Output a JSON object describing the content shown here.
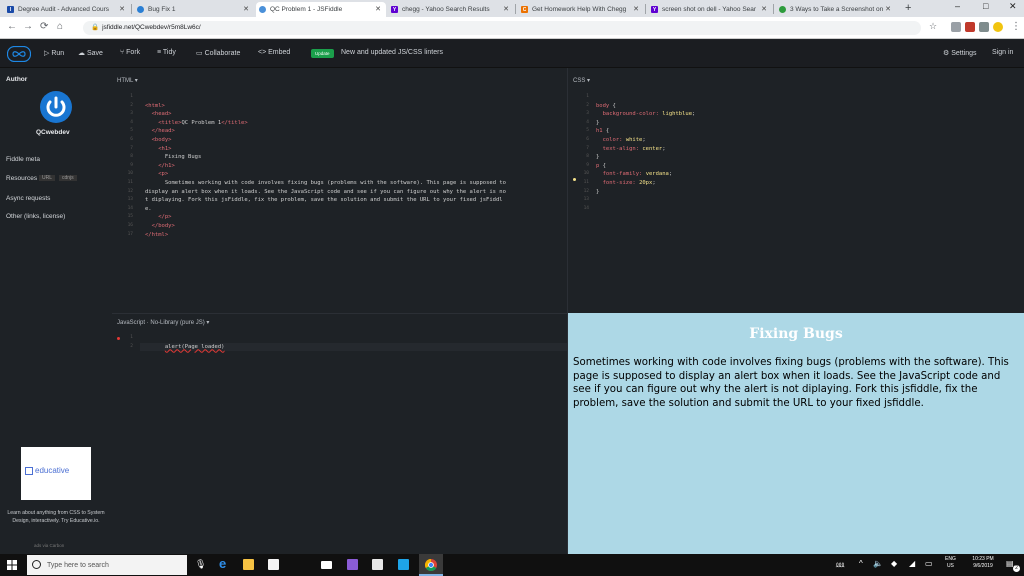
{
  "browser": {
    "tabs": [
      {
        "title": "Degree Audit - Advanced Cours",
        "color": "#1a4aa8",
        "glyph": "I"
      },
      {
        "title": "Bug Fix 1",
        "color": "#2a7fd4",
        "glyph": ""
      },
      {
        "title": "QC Problem 1 - JSFiddle",
        "color": "#4a90d9",
        "glyph": ""
      },
      {
        "title": "chegg - Yahoo Search Results",
        "color": "#5f01d1",
        "glyph": "Y"
      },
      {
        "title": "Get Homework Help With Chegg",
        "color": "#eb7100",
        "glyph": "C"
      },
      {
        "title": "screen shot on dell - Yahoo Sear",
        "color": "#5f01d1",
        "glyph": "Y"
      },
      {
        "title": "3 Ways to Take a Screenshot on",
        "color": "#2e9c3d",
        "glyph": ""
      }
    ],
    "url": "jsfiddle.net/QCwebdev/r5m8Lw6c/",
    "new_tab": "+",
    "window_controls": [
      "–",
      "□",
      "✕"
    ]
  },
  "toolbar": {
    "run": "Run",
    "save": "Save",
    "fork": "Fork",
    "tidy": "Tidy",
    "collaborate": "Collaborate",
    "embed": "Embed",
    "update_badge": "Update",
    "news": "New and updated JS/CSS linters",
    "settings": "Settings",
    "sign_in": "Sign in"
  },
  "sidebar": {
    "author_heading": "Author",
    "author_name": "QCwebdev",
    "fiddle_meta": "Fiddle meta",
    "resources": "Resources",
    "resources_url": "URL",
    "resources_cdnjs": "cdnjs",
    "async_requests": "Async requests",
    "other": "Other (links, license)",
    "ad_brand": "educative",
    "ad_text": "Learn about anything from CSS to System Design, interactively. Try Educative.io.",
    "ad_via": "ads via Carbon"
  },
  "html_panel": {
    "label": "HTML",
    "line_numbers": [
      "1",
      "2",
      "3",
      "4",
      "5",
      "6",
      "7",
      "8",
      "9",
      "10",
      "11",
      "12",
      "13",
      "14",
      "15",
      "16",
      "17"
    ]
  },
  "css_panel": {
    "label": "CSS",
    "line_numbers": [
      "1",
      "2",
      "3",
      "4",
      "5",
      "6",
      "7",
      "8",
      "9",
      "10",
      "11",
      "12",
      "13",
      "14"
    ]
  },
  "js_panel": {
    "label": "JavaScript",
    "library": "No-Library (pure JS)",
    "code": "alert(Page loaded)",
    "line_numbers": [
      "1",
      "2"
    ]
  },
  "result": {
    "heading": "Fixing Bugs",
    "paragraph": "Sometimes working with code involves fixing bugs (problems with the software). This page is supposed to display an alert box when it loads. See the JavaScript code and see if you can figure out why the alert is not diplaying. Fork this jsfiddle, fix the problem, save the solution and submit the URL to your fixed jsfiddle."
  },
  "taskbar": {
    "search_placeholder": "Type here to search",
    "lang": "ENG",
    "region": "US",
    "time": "10:23 PM",
    "date": "9/6/2019",
    "notif_count": "2"
  }
}
